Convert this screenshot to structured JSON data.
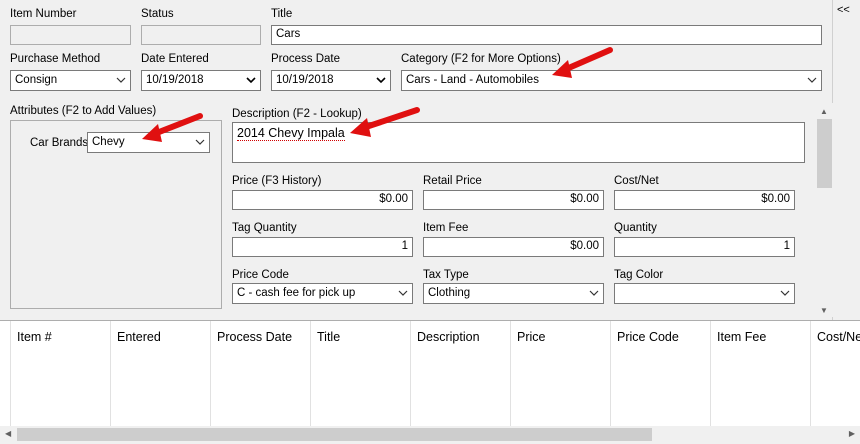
{
  "header": {
    "item_number": {
      "label": "Item Number",
      "value": ""
    },
    "status": {
      "label": "Status",
      "value": ""
    },
    "title": {
      "label": "Title",
      "value": "Cars"
    },
    "purchase_method": {
      "label": "Purchase Method",
      "value": "Consign"
    },
    "date_entered": {
      "label": "Date Entered",
      "value": "10/19/2018"
    },
    "process_date": {
      "label": "Process Date",
      "value": "10/19/2018"
    },
    "category": {
      "label": "Category (F2 for More Options)",
      "value": "Cars - Land - Automobiles"
    }
  },
  "collapse_label": "<<",
  "attributes": {
    "label": "Attributes (F2 to Add Values)",
    "car_brands": {
      "label": "Car Brands",
      "value": "Chevy"
    }
  },
  "details": {
    "description": {
      "label": "Description (F2 - Lookup)",
      "value": "2014 Chevy Impala"
    },
    "price": {
      "label": "Price (F3 History)",
      "value": "$0.00"
    },
    "retail_price": {
      "label": "Retail Price",
      "value": "$0.00"
    },
    "cost_net": {
      "label": "Cost/Net",
      "value": "$0.00"
    },
    "tag_quantity": {
      "label": "Tag Quantity",
      "value": "1"
    },
    "item_fee": {
      "label": "Item Fee",
      "value": "$0.00"
    },
    "quantity": {
      "label": "Quantity",
      "value": "1"
    },
    "price_code": {
      "label": "Price Code",
      "value": "C - cash fee for pick up"
    },
    "tax_type": {
      "label": "Tax Type",
      "value": "Clothing"
    },
    "tag_color": {
      "label": "Tag Color",
      "value": ""
    }
  },
  "grid": {
    "columns": [
      "Item #",
      "Entered",
      "Process Date",
      "Title",
      "Description",
      "Price",
      "Price Code",
      "Item Fee",
      "Cost/Ne"
    ]
  },
  "colors": {
    "arrow": "#e01010",
    "border": "#7a7a7a"
  }
}
